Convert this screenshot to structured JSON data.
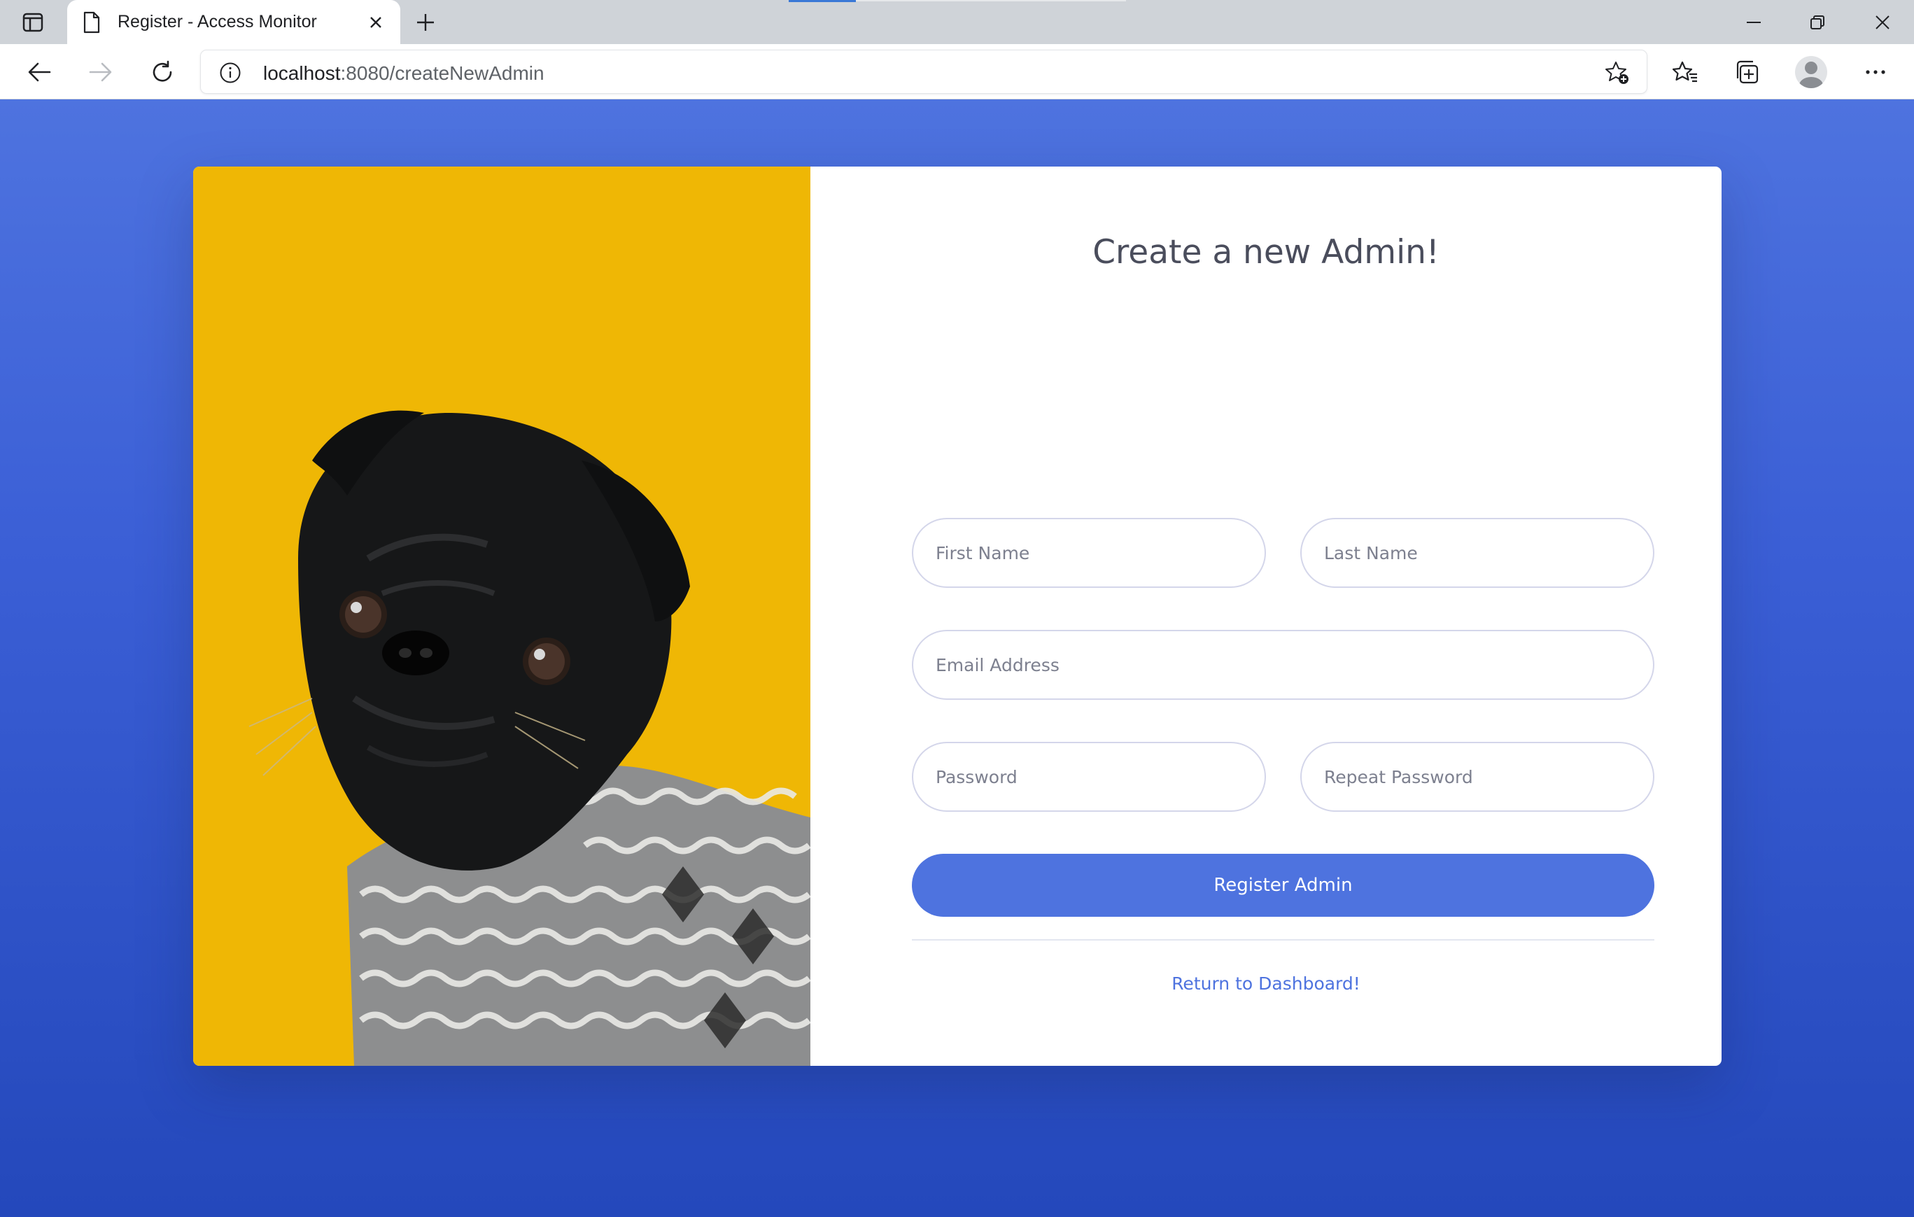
{
  "browser": {
    "tab_title": "Register - Access Monitor",
    "url_host": "localhost",
    "url_rest": ":8080/createNewAdmin",
    "icons": [
      "sidebar-toggle-icon",
      "page-icon",
      "close-icon",
      "plus-icon",
      "minimize-icon",
      "restore-icon",
      "close-window-icon",
      "back-icon",
      "forward-icon",
      "refresh-icon",
      "info-icon",
      "add-favorite-icon",
      "favorites-icon",
      "collections-icon",
      "profile-avatar",
      "more-icon"
    ]
  },
  "page": {
    "title": "Create a new Admin!",
    "fields": {
      "first_name_placeholder": "First Name",
      "last_name_placeholder": "Last Name",
      "email_placeholder": "Email Address",
      "password_placeholder": "Password",
      "repeat_password_placeholder": "Repeat Password"
    },
    "register_label": "Register Admin",
    "return_link": "Return to Dashboard!"
  },
  "colors": {
    "primary": "#4e73df",
    "background_top": "#4e73df",
    "background_bottom": "#2448bb",
    "photo_background": "#efb705"
  }
}
